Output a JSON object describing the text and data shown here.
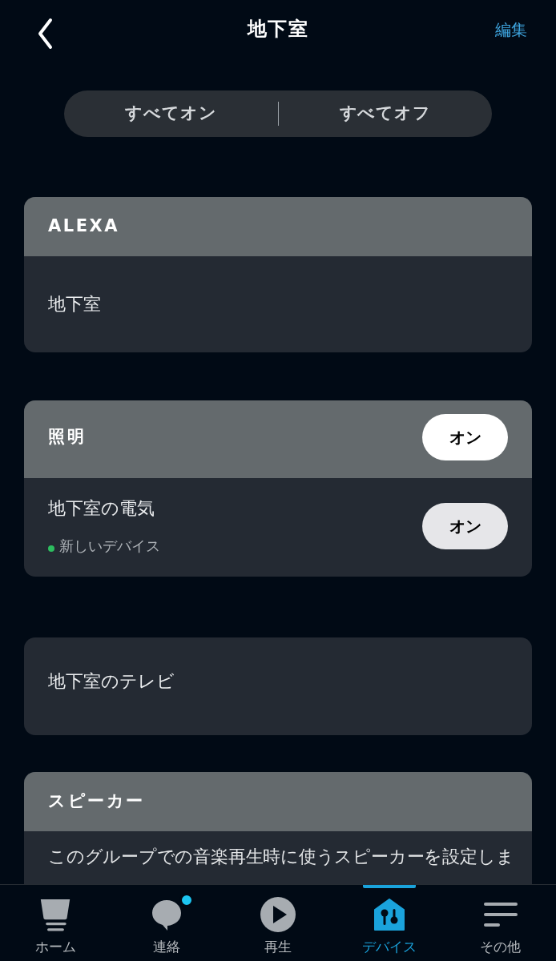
{
  "header": {
    "title": "地下室",
    "action": "編集"
  },
  "bulk_actions": [
    {
      "label": "すべてオン"
    },
    {
      "label": "すべてオフ"
    }
  ],
  "sections": [
    {
      "title": "ALEXA",
      "devices": [
        {
          "name": "地下室"
        }
      ]
    },
    {
      "title": "照明",
      "button": "オン",
      "devices": [
        {
          "name": "地下室の電気",
          "status": {
            "text": "新しいデバイス",
            "color": "#2dbd5f"
          },
          "button": "オン"
        }
      ]
    },
    {
      "devices": [
        {
          "name": "地下室のテレビ"
        }
      ]
    },
    {
      "title": "スピーカー",
      "description": "このグループでの音楽再生時に使うスピーカーを設定しま"
    }
  ],
  "tab_bar": [
    {
      "label": "ホーム",
      "selected": false,
      "notification": false
    },
    {
      "label": "連絡",
      "selected": false,
      "notification": true
    },
    {
      "label": "再生",
      "selected": false,
      "notification": false
    },
    {
      "label": "デバイス",
      "selected": true,
      "notification": false
    },
    {
      "label": "その他",
      "selected": false,
      "notification": false
    }
  ]
}
